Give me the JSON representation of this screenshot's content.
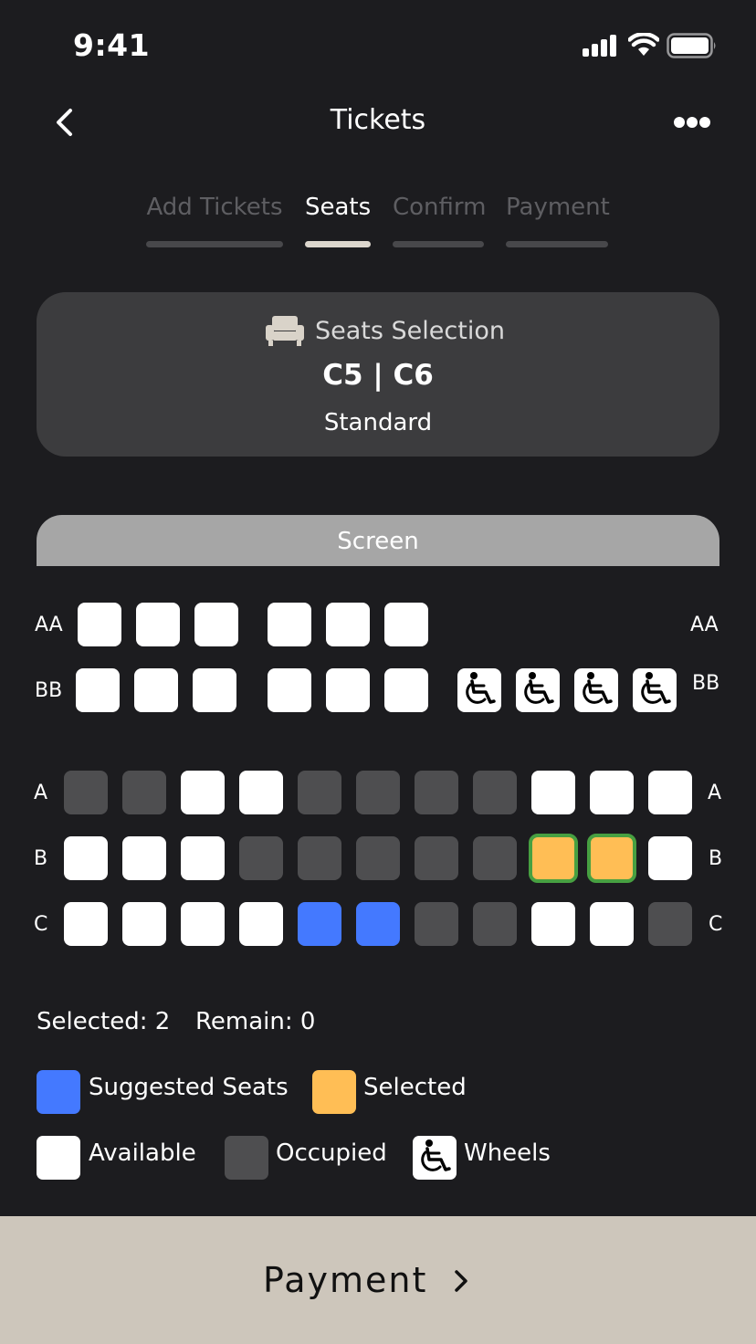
{
  "status_bar": {
    "time": "9:41"
  },
  "nav": {
    "title": "Tickets"
  },
  "tabs": [
    {
      "label": "Add Tickets",
      "active": false
    },
    {
      "label": "Seats",
      "active": true
    },
    {
      "label": "Confirm",
      "active": false
    },
    {
      "label": "Payment",
      "active": false
    }
  ],
  "selection": {
    "title": "Seats Selection",
    "seats": "C5 | C6",
    "type": "Standard"
  },
  "screen_label": "Screen",
  "rows": {
    "AA": {
      "label": "AA"
    },
    "BB": {
      "label": "BB"
    },
    "A": {
      "label": "A"
    },
    "B": {
      "label": "B"
    },
    "C": {
      "label": "C"
    }
  },
  "counts": {
    "selected": "Selected: 2",
    "remain": "Remain: 0"
  },
  "legend": {
    "suggested": "Suggested Seats",
    "selected": "Selected",
    "available": "Available",
    "occupied": "Occupied",
    "wheels": "Wheels"
  },
  "colors": {
    "suggested": "#4479ff",
    "selected": "#ffbe55",
    "selected_border": "#47a041",
    "available": "#ffffff",
    "occupied": "#4e4e50",
    "payment_bg": "#cdc6bb"
  },
  "payment": {
    "label": "Payment"
  }
}
